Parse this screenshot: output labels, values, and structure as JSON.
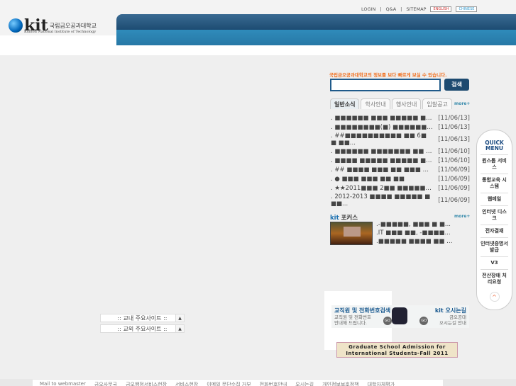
{
  "header": {
    "util_links": [
      "LOGIN",
      "Q&A",
      "SITEMAP"
    ],
    "lang_buttons": [
      "ENGLISH",
      "CHINESE"
    ],
    "logo_text": "kit",
    "logo_korean": "국립금오공과대학교",
    "logo_sub": "Kumoh National Institute of Technology"
  },
  "search": {
    "hint": "국립금오공과대학교의 정보를 보다 빠르게 보실 수 있습니다.",
    "placeholder": "",
    "button": "검색"
  },
  "news": {
    "tabs": [
      "일반소식",
      "학사안내",
      "행사안내",
      "입찰공고"
    ],
    "more": "more+",
    "items": [
      {
        "title": ". ■■■■■■ ■■■ ■■■■■ ■■ ■...",
        "date": "[11/06/13]"
      },
      {
        "title": ". ■■■■■■■■(■) ■■■■■■ ■■...",
        "date": "[11/06/13]"
      },
      {
        "title": ". ##■■■■■■■■■■ ■■ 6■ ■ ■■...",
        "date": "[11/06/13]"
      },
      {
        "title": ". ■■■■■■ ■■■■■■■ ■■ ■■",
        "date": "[11/06/10]"
      },
      {
        "title": ". ■■■■ ■■■■■ ■■■■■ ■■■...",
        "date": "[11/06/10]"
      },
      {
        "title": ". ## ■■■■ ■■■ ■■ ■■■ ■...",
        "date": "[11/06/09]"
      },
      {
        "title": ". ● ■■■ ■■■ ■■ ■■",
        "date": "[11/06/09]"
      },
      {
        "title": ". ★★2011■■■ 2■■ ■■■■■■ ■...",
        "date": "[11/06/09]"
      },
      {
        "title": ". 2012-2013 ■■■■ ■■■■■ ■ ■■...",
        "date": "[11/06/09]"
      }
    ]
  },
  "focus": {
    "title_kit": "kit",
    "title": "포커스",
    "more": "more+",
    "items": [
      ".-■■■■■, ■■■ ■ ■...",
      ".IT ■■■ ■■, -■■■■...",
      ".■■■■■ ■■■■ ■■ ■■ ..."
    ]
  },
  "banners": {
    "staff_title": "교직원 및 전화번호검색",
    "staff_sub1": "교직원 및 전화번호",
    "staff_sub2": "안내해 드립니다.",
    "go": "GO",
    "map_title_kit": "kit",
    "map_title": "오시는길",
    "map_sub1": "금오공대",
    "map_sub2": "오시는길 안내",
    "admission_1": "Graduate School Admission for",
    "admission_2": "International Students-Fall 2011"
  },
  "quick": {
    "title1": "QUICK",
    "title2": "MENU",
    "items": [
      "원스톱 서비스",
      "통합교육 시스템",
      "웹메일",
      "인터넷 디스크",
      "전자결재",
      "인터넷증명서 발급",
      "V3",
      "전산장애 처리요청"
    ],
    "up": "^"
  },
  "sites": {
    "inner": ":: 교내 주요사이트 ::",
    "outer": ":: 교외 주요사이트 ::",
    "arrow": "▲"
  },
  "footer": {
    "links": [
      "Mail to webmaster",
      "금오사무국",
      "금오행정서비스헌장",
      "서비스헌장",
      "이메일 무단수집 거부",
      "전화번호안내",
      "오시는길",
      "개인정보보호정책",
      "대학자체평가"
    ]
  }
}
